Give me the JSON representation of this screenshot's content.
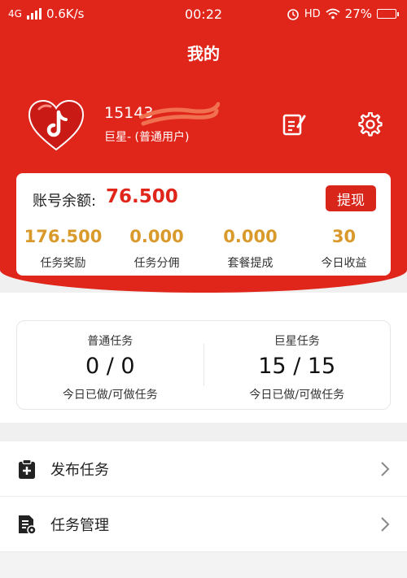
{
  "status_bar": {
    "network": "4G",
    "speed": "0.6K/s",
    "time": "00:22",
    "hd": "HD",
    "battery": "27%",
    "battery_level": 0.27
  },
  "header": {
    "title": "我的"
  },
  "profile": {
    "phone": "15143",
    "level": "巨星- (普通用户)",
    "accent": "#e0261b"
  },
  "balance": {
    "label": "账号余额:",
    "value": "76.500",
    "withdraw_label": "提现",
    "stats": [
      {
        "value": "176.500",
        "label": "任务奖励"
      },
      {
        "value": "0.000",
        "label": "任务分佣"
      },
      {
        "value": "0.000",
        "label": "套餐提成"
      },
      {
        "value": "30",
        "label": "今日收益"
      }
    ]
  },
  "tasks": [
    {
      "title": "普通任务",
      "count": "0 / 0",
      "sub": "今日已做/可做任务"
    },
    {
      "title": "巨星任务",
      "count": "15 / 15",
      "sub": "今日已做/可做任务"
    }
  ],
  "menu": [
    {
      "label": "发布任务",
      "icon": "clipboard-plus-icon"
    },
    {
      "label": "任务管理",
      "icon": "document-settings-icon"
    }
  ],
  "colors": {
    "brand_red": "#e0261b",
    "gold": "#d99a2b"
  }
}
